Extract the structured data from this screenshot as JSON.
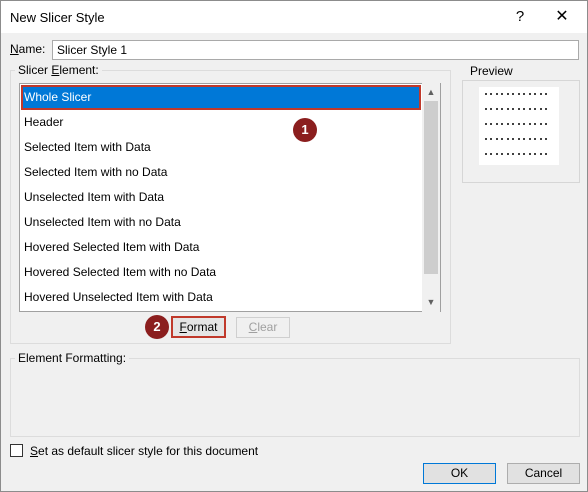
{
  "window": {
    "title": "New Slicer Style",
    "help_glyph": "?",
    "close_glyph": "✕"
  },
  "name_field": {
    "label": "Name:",
    "value": "Slicer Style 1"
  },
  "slicer_element": {
    "label": "Slicer Element:",
    "items": [
      "Whole Slicer",
      "Header",
      "Selected Item with Data",
      "Selected Item with no Data",
      "Unselected Item with Data",
      "Unselected Item with no Data",
      "Hovered Selected Item with Data",
      "Hovered Selected Item with no Data",
      "Hovered Unselected Item with Data"
    ],
    "selected_index": 0
  },
  "annotations": {
    "marker1": "1",
    "marker2": "2"
  },
  "buttons": {
    "format": "Format",
    "clear": "Clear",
    "ok": "OK",
    "cancel": "Cancel"
  },
  "preview": {
    "label": "Preview"
  },
  "element_formatting": {
    "label": "Element Formatting:"
  },
  "default_option": {
    "label": "Set as default slicer style for this document",
    "checked": false
  },
  "colors": {
    "selection": "#0078d7",
    "annotation_red": "#c0392b",
    "badge": "#8b1e1e"
  },
  "icons": {
    "scroll_up": "chevron-up-icon",
    "scroll_down": "chevron-down-icon"
  }
}
